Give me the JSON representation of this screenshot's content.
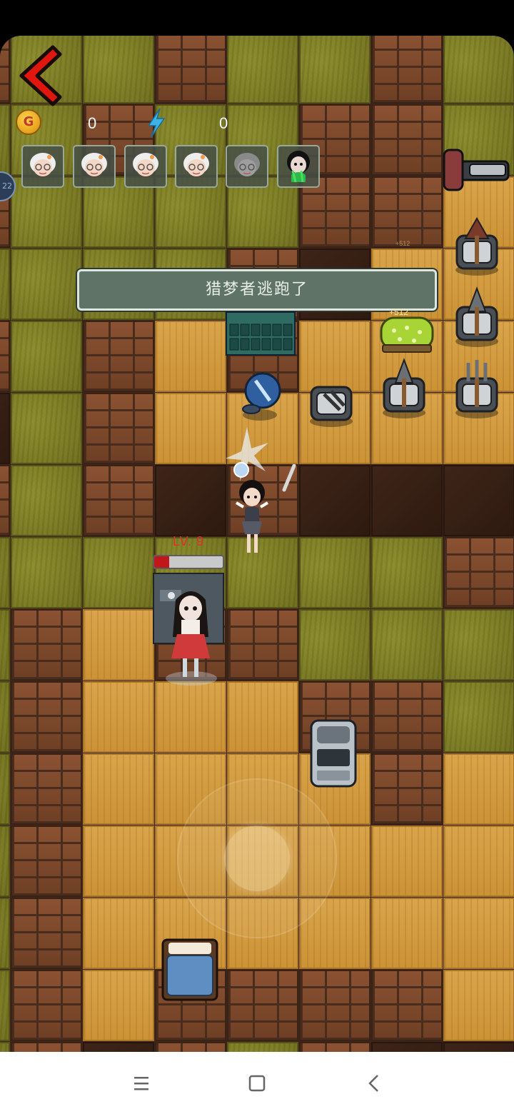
{
  "hud": {
    "gold_value": "0",
    "gold_symbol": "G",
    "energy_value": "0",
    "side_tab_text": "22"
  },
  "players": [
    {
      "name": "grandma-avatar",
      "state": "active"
    },
    {
      "name": "grandma-avatar",
      "state": "active"
    },
    {
      "name": "grandma-avatar",
      "state": "active"
    },
    {
      "name": "grandma-avatar",
      "state": "active"
    },
    {
      "name": "grandma-avatar",
      "state": "grey"
    },
    {
      "name": "ghost-girl-avatar",
      "state": "poisoned"
    }
  ],
  "notice": {
    "text": "猎梦者逃跑了"
  },
  "enemy": {
    "level_label": "LV. 9",
    "health_fraction": 0.22
  },
  "coin_badges": {
    "bed_income": "+512",
    "small_income": "+512"
  },
  "colors": {
    "back_arrow": "#e0160f",
    "health_fill": "#c0171b",
    "banner_bg": "#5f7467",
    "floor": "#d9a44a",
    "grass": "#7a7a22",
    "wall": "#8a5232"
  },
  "navigation": {
    "menu_icon": "menu-icon",
    "home_icon": "home-icon",
    "back_icon": "back-icon"
  }
}
